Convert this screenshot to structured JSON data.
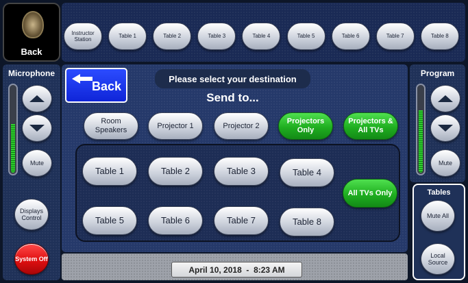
{
  "header": {
    "back_label": "Back",
    "tabs": [
      "Instructor Station",
      "Table 1",
      "Table 2",
      "Table 3",
      "Table 4",
      "Table 5",
      "Table 6",
      "Table 7",
      "Table 8"
    ]
  },
  "left": {
    "title": "Microphone",
    "mute_label": "Mute",
    "displays_label": "Displays Control",
    "system_off_label": "System Off",
    "level_fraction": 0.55
  },
  "right": {
    "title": "Program",
    "mute_label": "Mute",
    "tables_title": "Tables",
    "mute_all_label": "Mute All",
    "local_source_label": "Local Source",
    "level_fraction": 0.7
  },
  "main": {
    "back_label": "Back",
    "prompt": "Please select your destination",
    "send_to": "Send to...",
    "destinations": [
      {
        "label": "Room Speakers",
        "style": "gray"
      },
      {
        "label": "Projector 1",
        "style": "gray"
      },
      {
        "label": "Projector 2",
        "style": "gray"
      },
      {
        "label": "Projectors Only",
        "style": "green"
      },
      {
        "label": "Projectors & All TVs",
        "style": "green"
      }
    ],
    "tables_row1": [
      "Table 1",
      "Table 2",
      "Table 3",
      "Table 4"
    ],
    "tables_row2": [
      "Table 5",
      "Table 6",
      "Table 7",
      "Table 8"
    ],
    "all_tvs_label": "All TVs Only"
  },
  "footer": {
    "datetime": "April 10, 2018  -  8:23 AM"
  },
  "colors": {
    "accent_green": "#1fae20",
    "accent_red": "#e00f10",
    "back_blue": "#1530e8"
  }
}
